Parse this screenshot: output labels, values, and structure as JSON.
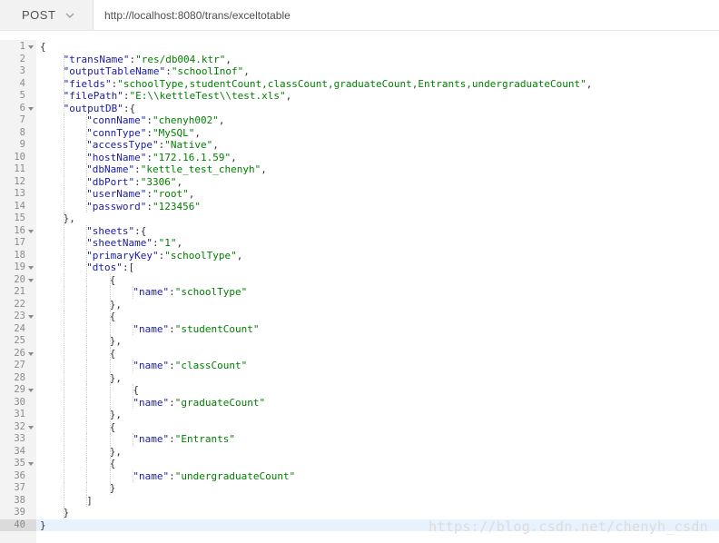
{
  "request": {
    "method": "POST",
    "url": "http://localhost:8080/trans/exceltotable"
  },
  "editor": {
    "active_line": 40,
    "lines": [
      {
        "n": "1",
        "indent": 0,
        "fold": true,
        "tokens": [
          {
            "t": "p",
            "v": "{"
          }
        ]
      },
      {
        "n": "2",
        "indent": 1,
        "fold": false,
        "tokens": [
          {
            "t": "k",
            "v": "\"transName\""
          },
          {
            "t": "p",
            "v": ":"
          },
          {
            "t": "s",
            "v": "\"res/db004.ktr\""
          },
          {
            "t": "p",
            "v": ","
          }
        ]
      },
      {
        "n": "3",
        "indent": 1,
        "fold": false,
        "tokens": [
          {
            "t": "k",
            "v": "\"outputTableName\""
          },
          {
            "t": "p",
            "v": ":"
          },
          {
            "t": "s",
            "v": "\"schoolInof\""
          },
          {
            "t": "p",
            "v": ","
          }
        ]
      },
      {
        "n": "4",
        "indent": 1,
        "fold": false,
        "tokens": [
          {
            "t": "k",
            "v": "\"fields\""
          },
          {
            "t": "p",
            "v": ":"
          },
          {
            "t": "s",
            "v": "\"schoolType,studentCount,classCount,graduateCount,Entrants,undergraduateCount\""
          },
          {
            "t": "p",
            "v": ","
          }
        ]
      },
      {
        "n": "5",
        "indent": 1,
        "fold": false,
        "tokens": [
          {
            "t": "k",
            "v": "\"filePath\""
          },
          {
            "t": "p",
            "v": ":"
          },
          {
            "t": "s",
            "v": "\"E:\\\\kettleTest\\\\test.xls\""
          },
          {
            "t": "p",
            "v": ","
          }
        ]
      },
      {
        "n": "6",
        "indent": 1,
        "fold": true,
        "tokens": [
          {
            "t": "k",
            "v": "\"outputDB\""
          },
          {
            "t": "p",
            "v": ":{"
          }
        ]
      },
      {
        "n": "7",
        "indent": 2,
        "fold": false,
        "tokens": [
          {
            "t": "k",
            "v": "\"connName\""
          },
          {
            "t": "p",
            "v": ":"
          },
          {
            "t": "s",
            "v": "\"chenyh002\""
          },
          {
            "t": "p",
            "v": ","
          }
        ]
      },
      {
        "n": "8",
        "indent": 2,
        "fold": false,
        "tokens": [
          {
            "t": "k",
            "v": "\"connType\""
          },
          {
            "t": "p",
            "v": ":"
          },
          {
            "t": "s",
            "v": "\"MySQL\""
          },
          {
            "t": "p",
            "v": ","
          }
        ]
      },
      {
        "n": "9",
        "indent": 2,
        "fold": false,
        "tokens": [
          {
            "t": "k",
            "v": "\"accessType\""
          },
          {
            "t": "p",
            "v": ":"
          },
          {
            "t": "s",
            "v": "\"Native\""
          },
          {
            "t": "p",
            "v": ","
          }
        ]
      },
      {
        "n": "10",
        "indent": 2,
        "fold": false,
        "tokens": [
          {
            "t": "k",
            "v": "\"hostName\""
          },
          {
            "t": "p",
            "v": ":"
          },
          {
            "t": "s",
            "v": "\"172.16.1.59\""
          },
          {
            "t": "p",
            "v": ","
          }
        ]
      },
      {
        "n": "11",
        "indent": 2,
        "fold": false,
        "tokens": [
          {
            "t": "k",
            "v": "\"dbName\""
          },
          {
            "t": "p",
            "v": ":"
          },
          {
            "t": "s",
            "v": "\"kettle_test_chenyh\""
          },
          {
            "t": "p",
            "v": ","
          }
        ]
      },
      {
        "n": "12",
        "indent": 2,
        "fold": false,
        "tokens": [
          {
            "t": "k",
            "v": "\"dbPort\""
          },
          {
            "t": "p",
            "v": ":"
          },
          {
            "t": "s",
            "v": "\"3306\""
          },
          {
            "t": "p",
            "v": ","
          }
        ]
      },
      {
        "n": "13",
        "indent": 2,
        "fold": false,
        "tokens": [
          {
            "t": "k",
            "v": "\"userName\""
          },
          {
            "t": "p",
            "v": ":"
          },
          {
            "t": "s",
            "v": "\"root\""
          },
          {
            "t": "p",
            "v": ","
          }
        ]
      },
      {
        "n": "14",
        "indent": 2,
        "fold": false,
        "tokens": [
          {
            "t": "k",
            "v": "\"password\""
          },
          {
            "t": "p",
            "v": ":"
          },
          {
            "t": "s",
            "v": "\"123456\""
          }
        ]
      },
      {
        "n": "15",
        "indent": 1,
        "fold": false,
        "tokens": [
          {
            "t": "p",
            "v": "},"
          }
        ]
      },
      {
        "n": "16",
        "indent": 2,
        "fold": true,
        "tokens": [
          {
            "t": "k",
            "v": "\"sheets\""
          },
          {
            "t": "p",
            "v": ":{"
          }
        ]
      },
      {
        "n": "17",
        "indent": 2,
        "fold": false,
        "tokens": [
          {
            "t": "k",
            "v": "\"sheetName\""
          },
          {
            "t": "p",
            "v": ":"
          },
          {
            "t": "s",
            "v": "\"1\""
          },
          {
            "t": "p",
            "v": ","
          }
        ]
      },
      {
        "n": "18",
        "indent": 2,
        "fold": false,
        "tokens": [
          {
            "t": "k",
            "v": "\"primaryKey\""
          },
          {
            "t": "p",
            "v": ":"
          },
          {
            "t": "s",
            "v": "\"schoolType\""
          },
          {
            "t": "p",
            "v": ","
          }
        ]
      },
      {
        "n": "19",
        "indent": 2,
        "fold": true,
        "tokens": [
          {
            "t": "k",
            "v": "\"dtos\""
          },
          {
            "t": "p",
            "v": ":["
          }
        ]
      },
      {
        "n": "20",
        "indent": 3,
        "fold": true,
        "tokens": [
          {
            "t": "p",
            "v": "{"
          }
        ]
      },
      {
        "n": "21",
        "indent": 4,
        "fold": false,
        "tokens": [
          {
            "t": "k",
            "v": "\"name\""
          },
          {
            "t": "p",
            "v": ":"
          },
          {
            "t": "s",
            "v": "\"schoolType\""
          }
        ]
      },
      {
        "n": "22",
        "indent": 3,
        "fold": false,
        "tokens": [
          {
            "t": "p",
            "v": "},"
          }
        ]
      },
      {
        "n": "23",
        "indent": 3,
        "fold": true,
        "tokens": [
          {
            "t": "p",
            "v": "{"
          }
        ]
      },
      {
        "n": "24",
        "indent": 4,
        "fold": false,
        "tokens": [
          {
            "t": "k",
            "v": "\"name\""
          },
          {
            "t": "p",
            "v": ":"
          },
          {
            "t": "s",
            "v": "\"studentCount\""
          }
        ]
      },
      {
        "n": "25",
        "indent": 3,
        "fold": false,
        "tokens": [
          {
            "t": "p",
            "v": "},"
          }
        ]
      },
      {
        "n": "26",
        "indent": 3,
        "fold": true,
        "tokens": [
          {
            "t": "p",
            "v": "{"
          }
        ]
      },
      {
        "n": "27",
        "indent": 4,
        "fold": false,
        "tokens": [
          {
            "t": "k",
            "v": "\"name\""
          },
          {
            "t": "p",
            "v": ":"
          },
          {
            "t": "s",
            "v": "\"classCount\""
          }
        ]
      },
      {
        "n": "28",
        "indent": 3,
        "fold": false,
        "tokens": [
          {
            "t": "p",
            "v": "},"
          }
        ]
      },
      {
        "n": "29",
        "indent": 4,
        "fold": true,
        "tokens": [
          {
            "t": "p",
            "v": "{"
          }
        ]
      },
      {
        "n": "30",
        "indent": 4,
        "fold": false,
        "tokens": [
          {
            "t": "k",
            "v": "\"name\""
          },
          {
            "t": "p",
            "v": ":"
          },
          {
            "t": "s",
            "v": "\"graduateCount\""
          }
        ]
      },
      {
        "n": "31",
        "indent": 3,
        "fold": false,
        "tokens": [
          {
            "t": "p",
            "v": "},"
          }
        ]
      },
      {
        "n": "32",
        "indent": 3,
        "fold": true,
        "tokens": [
          {
            "t": "p",
            "v": "{"
          }
        ]
      },
      {
        "n": "33",
        "indent": 4,
        "fold": false,
        "tokens": [
          {
            "t": "k",
            "v": "\"name\""
          },
          {
            "t": "p",
            "v": ":"
          },
          {
            "t": "s",
            "v": "\"Entrants\""
          }
        ]
      },
      {
        "n": "34",
        "indent": 3,
        "fold": false,
        "tokens": [
          {
            "t": "p",
            "v": "},"
          }
        ]
      },
      {
        "n": "35",
        "indent": 3,
        "fold": true,
        "tokens": [
          {
            "t": "p",
            "v": "{"
          }
        ]
      },
      {
        "n": "36",
        "indent": 4,
        "fold": false,
        "tokens": [
          {
            "t": "k",
            "v": "\"name\""
          },
          {
            "t": "p",
            "v": ":"
          },
          {
            "t": "s",
            "v": "\"undergraduateCount\""
          }
        ]
      },
      {
        "n": "37",
        "indent": 3,
        "fold": false,
        "tokens": [
          {
            "t": "p",
            "v": "}"
          }
        ]
      },
      {
        "n": "38",
        "indent": 2,
        "fold": false,
        "tokens": [
          {
            "t": "p",
            "v": "]"
          }
        ]
      },
      {
        "n": "39",
        "indent": 1,
        "fold": false,
        "tokens": [
          {
            "t": "p",
            "v": "}"
          }
        ]
      },
      {
        "n": "40",
        "indent": 0,
        "fold": false,
        "tokens": [
          {
            "t": "p",
            "v": "}"
          }
        ]
      }
    ]
  },
  "watermark": "https://blog.csdn.net/chenyh_csdn",
  "colors": {
    "key": "#1a1aa6",
    "string": "#008000",
    "active_line": "#e8f2fe"
  }
}
